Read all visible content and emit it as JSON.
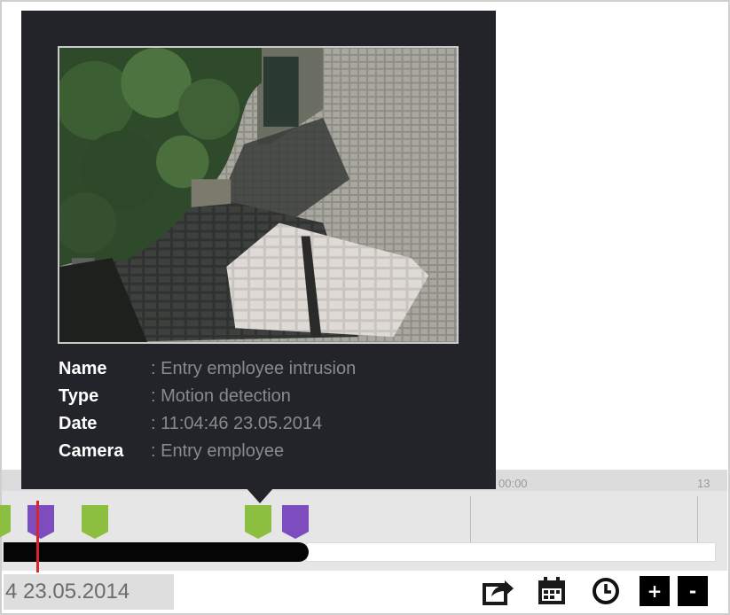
{
  "tooltip": {
    "rows": [
      {
        "key": "Name",
        "value": ": Entry employee intrusion"
      },
      {
        "key": "Type",
        "value": ": Motion detection"
      },
      {
        "key": "Date",
        "value": ": 11:04:46 23.05.2014"
      },
      {
        "key": "Camera",
        "value": ": Entry employee"
      }
    ]
  },
  "timeline": {
    "tick_labels": [
      "00:00",
      "13"
    ],
    "markers": [
      {
        "type": "motion",
        "color": "#8cbf3f"
      },
      {
        "type": "alarm",
        "color": "#7d4cbe"
      },
      {
        "type": "motion",
        "color": "#8cbf3f"
      },
      {
        "type": "motion",
        "color": "#8cbf3f"
      },
      {
        "type": "alarm",
        "color": "#7d4cbe"
      }
    ],
    "playhead_color": "#d7262f"
  },
  "bottombar": {
    "date_text": "4 23.05.2014",
    "tools": [
      "export-icon",
      "calendar-icon",
      "clock-icon"
    ],
    "zoom_in_label": "+",
    "zoom_out_label": "-"
  }
}
